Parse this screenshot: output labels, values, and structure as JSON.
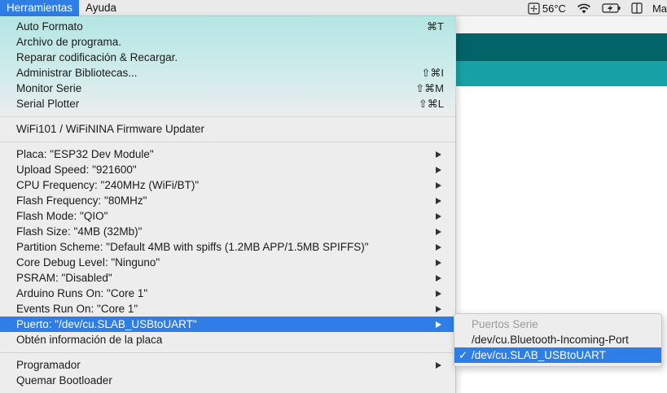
{
  "menubar": {
    "items": [
      {
        "label": "Herramientas",
        "active": true
      },
      {
        "label": "Ayuda",
        "active": false
      }
    ],
    "status": {
      "temperature": "56°C",
      "user_partial": "Ma"
    }
  },
  "menu": {
    "groups": [
      [
        {
          "label": "Auto Formato",
          "shortcut": "⌘T"
        },
        {
          "label": "Archivo de programa.",
          "shortcut": ""
        },
        {
          "label": "Reparar codificación & Recargar.",
          "shortcut": ""
        },
        {
          "label": "Administrar Bibliotecas...",
          "shortcut": "⇧⌘I"
        },
        {
          "label": "Monitor Serie",
          "shortcut": "⇧⌘M"
        },
        {
          "label": "Serial Plotter",
          "shortcut": "⇧⌘L"
        }
      ],
      [
        {
          "label": "WiFi101 / WiFiNINA Firmware Updater",
          "shortcut": ""
        }
      ],
      [
        {
          "label": "Placa: \"ESP32 Dev Module\"",
          "submenu": true
        },
        {
          "label": "Upload Speed: \"921600\"",
          "submenu": true
        },
        {
          "label": "CPU Frequency: \"240MHz (WiFi/BT)\"",
          "submenu": true
        },
        {
          "label": "Flash Frequency: \"80MHz\"",
          "submenu": true
        },
        {
          "label": "Flash Mode: \"QIO\"",
          "submenu": true
        },
        {
          "label": "Flash Size: \"4MB (32Mb)\"",
          "submenu": true
        },
        {
          "label": "Partition Scheme: \"Default 4MB with spiffs (1.2MB APP/1.5MB SPIFFS)\"",
          "submenu": true
        },
        {
          "label": "Core Debug Level: \"Ninguno\"",
          "submenu": true
        },
        {
          "label": "PSRAM: \"Disabled\"",
          "submenu": true
        },
        {
          "label": "Arduino Runs On: \"Core 1\"",
          "submenu": true
        },
        {
          "label": "Events Run On: \"Core 1\"",
          "submenu": true
        },
        {
          "label": "Puerto: \"/dev/cu.SLAB_USBtoUART\"",
          "submenu": true,
          "highlighted": true
        },
        {
          "label": "Obtén información de la placa",
          "submenu": false
        }
      ],
      [
        {
          "label": "Programador",
          "submenu": true
        },
        {
          "label": "Quemar Bootloader",
          "submenu": false
        }
      ]
    ]
  },
  "submenu": {
    "header": "Puertos Serie",
    "items": [
      {
        "label": "/dev/cu.Bluetooth-Incoming-Port",
        "checked": false
      },
      {
        "label": "/dev/cu.SLAB_USBtoUART",
        "checked": true
      }
    ],
    "check_glyph": "✓"
  },
  "colors": {
    "highlight": "#2f7de6",
    "app_dark_teal": "#006468",
    "app_teal": "#17a1a5"
  }
}
